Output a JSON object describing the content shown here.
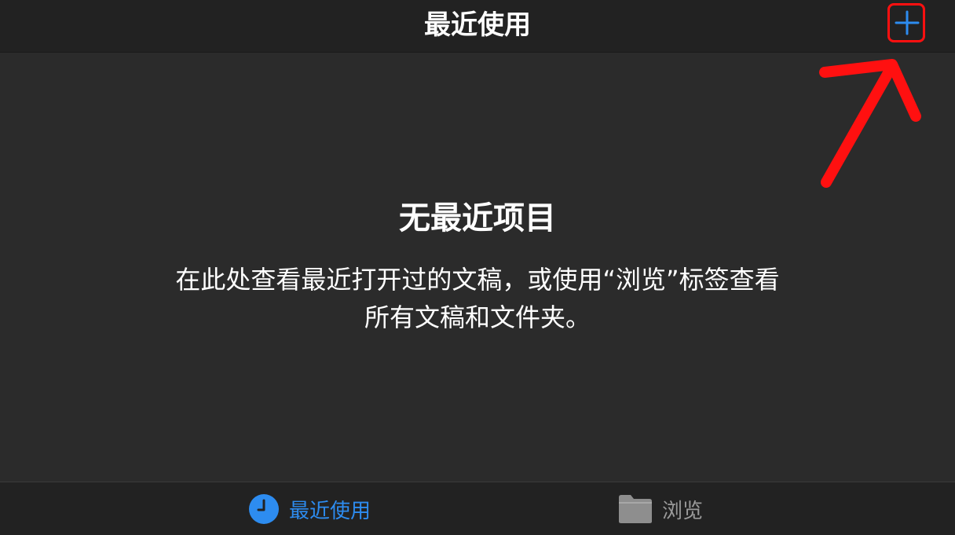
{
  "nav": {
    "title": "最近使用"
  },
  "empty_state": {
    "title": "无最近项目",
    "description": "在此处查看最近打开过的文稿，或使用“浏览”标签查看所有文稿和文件夹。"
  },
  "tabs": [
    {
      "label": "最近使用",
      "icon": "clock-icon",
      "selected": true
    },
    {
      "label": "浏览",
      "icon": "folder-icon",
      "selected": false
    }
  ],
  "colors": {
    "accent": "#2d8cf0",
    "annotation": "#ff1010",
    "background": "#2b2b2b",
    "bar": "#222222",
    "inactive": "#9a9a9a"
  }
}
